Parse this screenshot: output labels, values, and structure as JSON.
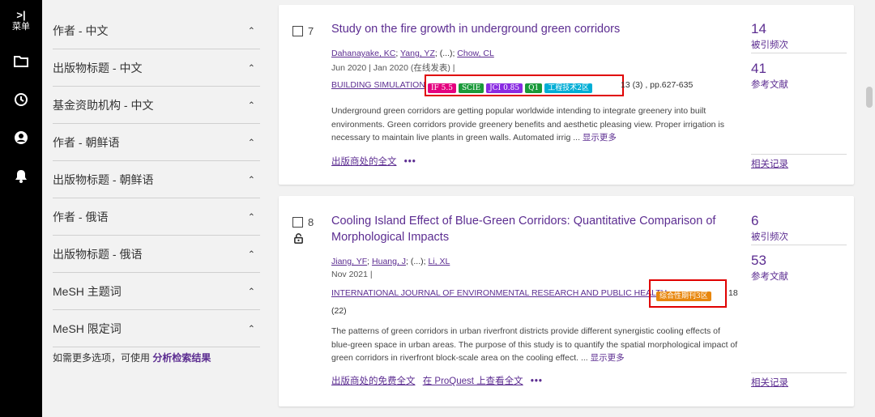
{
  "rail": {
    "menu_label": "菜单",
    "icons": [
      "folder-icon",
      "history-icon",
      "user-icon",
      "bell-icon"
    ]
  },
  "filters": {
    "items": [
      {
        "label": "作者 - 中文"
      },
      {
        "label": "出版物标题 - 中文"
      },
      {
        "label": "基金资助机构 - 中文"
      },
      {
        "label": "作者 - 朝鲜语"
      },
      {
        "label": "出版物标题 - 朝鲜语"
      },
      {
        "label": "作者 - 俄语"
      },
      {
        "label": "出版物标题 - 俄语"
      },
      {
        "label": "MeSH 主题词"
      },
      {
        "label": "MeSH 限定词"
      }
    ],
    "more_options_text": "如需更多选项，可使用",
    "more_options_link": "分析检索结果"
  },
  "results": [
    {
      "number": "7",
      "title": "Study on the fire growth in underground green corridors",
      "authors": [
        "Dahanayake, KC",
        "Yang, YZ",
        "Chow, CL"
      ],
      "authors_sep": "; (...);",
      "date": "Jun 2020 | Jan 2020 (在线发表) |",
      "journal": "BUILDING SIMULATION",
      "badges": [
        {
          "text": "IF 5.5",
          "color": "#e4007f"
        },
        {
          "text": "SCIE",
          "color": "#1a9a3a"
        },
        {
          "text": "JCI 0.85",
          "color": "#8a2be2"
        },
        {
          "text": "Q1",
          "color": "#1a9a3a"
        },
        {
          "text": "工程技术2区",
          "color": "#00aed6"
        }
      ],
      "volume": "13 (3) , pp.627-635",
      "abstract": "Underground green corridors are getting popular worldwide intending to integrate greenery into built environments. Green corridors provide greenery benefits and aesthetic pleasing view. Proper irrigation is necessary to maintain live plants in green walls. Automated irrig ...",
      "show_more": "显示更多",
      "links": [
        "出版商处的全文"
      ],
      "citations": "14",
      "citations_label": "被引频次",
      "references": "41",
      "references_label": "参考文献",
      "related": "相关记录"
    },
    {
      "number": "8",
      "title": "Cooling Island Effect of Blue-Green Corridors: Quantitative Comparison of Morphological Impacts",
      "authors": [
        "Jiang, YF",
        "Huang, J",
        "Li, XL"
      ],
      "authors_sep": "; (...);",
      "date": "Nov 2021 |",
      "journal": "INTERNATIONAL JOURNAL OF ENVIRONMENTAL RESEARCH AND PUBLIC HEALTH",
      "badges": [
        {
          "text": "综合性期刊3区",
          "color": "#e8870e"
        }
      ],
      "volume": "18",
      "issue": "(22)",
      "abstract": "The patterns of green corridors in urban riverfront districts provide different synergistic cooling effects of blue-green space in urban areas. The purpose of this study is to quantify the spatial morphological impact of green corridors in riverfront block-scale area on the cooling effect. ...",
      "show_more": "显示更多",
      "links": [
        "出版商处的免费全文",
        "在 ProQuest 上查看全文"
      ],
      "citations": "6",
      "citations_label": "被引频次",
      "references": "53",
      "references_label": "参考文献",
      "related": "相关记录"
    }
  ],
  "more_icon": "more-dots-icon"
}
